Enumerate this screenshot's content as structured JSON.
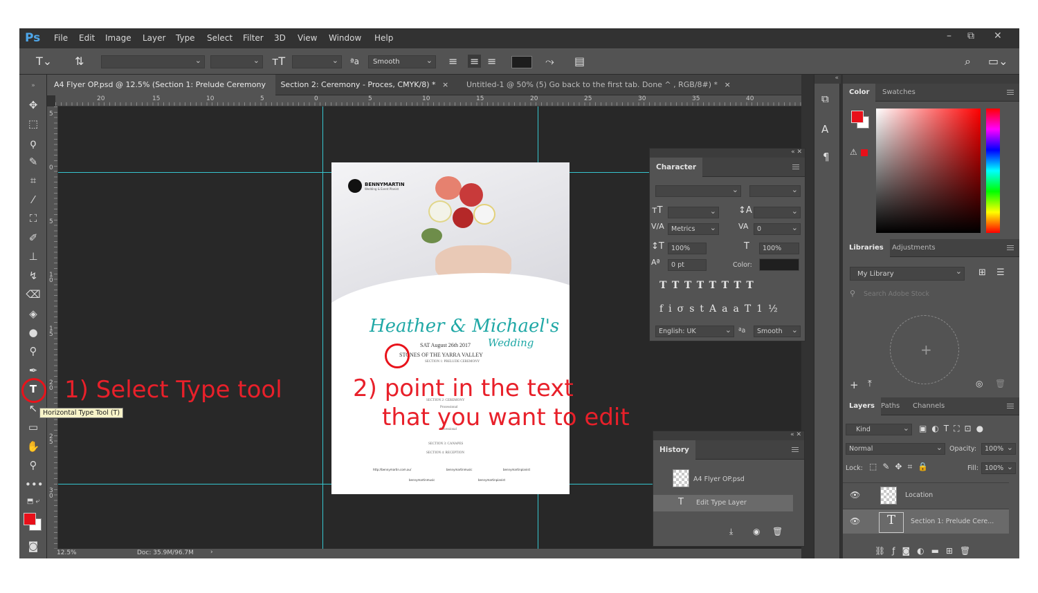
{
  "app": {
    "logo": "Ps"
  },
  "menu": [
    "File",
    "Edit",
    "Image",
    "Layer",
    "Type",
    "Select",
    "Filter",
    "3D",
    "View",
    "Window",
    "Help"
  ],
  "window_controls": {
    "minimize": "–",
    "restore": "⧉",
    "close": "✕"
  },
  "options_bar": {
    "antialias": "Smooth",
    "antialias_label": "ªa"
  },
  "tabs": [
    {
      "label": "A4 Flyer OP.psd @ 12.5% (Section 1: Prelude Ceremony"
    },
    {
      "label": "Section 2: Ceremony - Proces, CMYK/8) *",
      "close": "×"
    },
    {
      "label": "Untitled-1 @ 50% (5) Go back to the first tab. Done ^ , RGB/8#) *",
      "close": "×"
    }
  ],
  "ruler": {
    "h_labels": [
      "20",
      "15",
      "10",
      "5",
      "0",
      "5",
      "10",
      "15",
      "20",
      "25",
      "30",
      "35",
      "40"
    ],
    "v_labels": [
      "5",
      "0",
      "5",
      "1 0",
      "1 5",
      "2 0",
      "2 5",
      "3 0"
    ]
  },
  "status": {
    "zoom": "12.5%",
    "doc": "Doc: 35.9M/96.7M",
    "arrow": "›"
  },
  "tooltip": "Horizontal Type Tool (T)",
  "annotations": {
    "step1": "1) Select Type tool",
    "step2_line1": "2) point in the text",
    "step2_line2": "that you want to edit"
  },
  "flyer": {
    "brand": "BENNYMARTIN",
    "brand_sub": "Wedding & Event Planist",
    "names": "Heather & Michael's",
    "date": "SAT August 26th 2017",
    "wedding": "Wedding",
    "venue": "STONES OF THE YARRA VALLEY",
    "section1": "SECTION 1: PRELUDE CEREMONY",
    "section2": "SECTION 2: CEREMONY",
    "processional": "Processional",
    "recessional": "Recessional",
    "section3": "SECTION 3: CANAPES",
    "section4": "SECTION 4: RECEPTION",
    "website": "http://bennymartin.com.au/",
    "social1": "bennymartinmusic",
    "social2": "bennymartinpianist",
    "social3": "bennymartinmusic",
    "social4": "bennymartinpianist"
  },
  "character_panel": {
    "title": "Character",
    "tracking_label": "Metrics",
    "kerning_value": "0",
    "vertical_scale": "100%",
    "horizontal_scale": "100%",
    "baseline": "0 pt",
    "color_label": "Color:",
    "language": "English: UK",
    "antialias": "Smooth",
    "antialias_label": "ªa"
  },
  "history_panel": {
    "title": "History",
    "items": [
      "A4 Flyer OP.psd",
      "Edit Type Layer"
    ]
  },
  "color_panel": {
    "tabs": [
      "Color",
      "Swatches"
    ]
  },
  "libraries_panel": {
    "tabs": [
      "Libraries",
      "Adjustments"
    ],
    "library": "My Library",
    "search_placeholder": "Search Adobe Stock"
  },
  "layers_panel": {
    "tabs": [
      "Layers",
      "Paths",
      "Channels"
    ],
    "filter": "Kind",
    "blend_mode": "Normal",
    "opacity_label": "Opacity:",
    "opacity": "100%",
    "lock_label": "Lock:",
    "fill_label": "Fill:",
    "fill": "100%",
    "layers": [
      "Location",
      "Section 1: Prelude Cere..."
    ]
  },
  "colors": {
    "foreground": "#e8101a",
    "background": "#ffffff",
    "guide": "#36c7d1",
    "annotation": "#e8202a",
    "teal_text": "#20a8a6"
  }
}
